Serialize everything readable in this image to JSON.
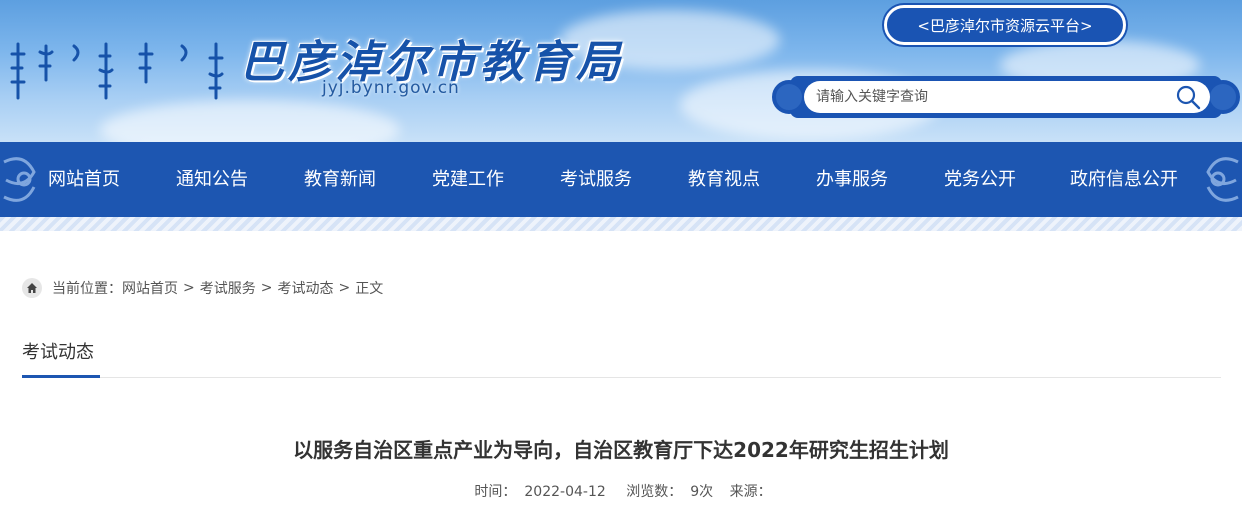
{
  "header": {
    "site_title": "巴彦淖尔市教育局",
    "site_domain": "jyj.bynr.gov.cn",
    "platform_link": "<巴彦淖尔市资源云平台>",
    "search_placeholder": "请输入关键字查询"
  },
  "nav": {
    "items": [
      "网站首页",
      "通知公告",
      "教育新闻",
      "党建工作",
      "考试服务",
      "教育视点",
      "办事服务",
      "党务公开",
      "政府信息公开"
    ]
  },
  "breadcrumb": {
    "label": "当前位置：",
    "items": [
      "网站首页",
      "考试服务",
      "考试动态",
      "正文"
    ],
    "separator": ">"
  },
  "section": {
    "title": "考试动态"
  },
  "article": {
    "title": "以服务自治区重点产业为导向，自治区教育厅下达2022年研究生招生计划",
    "time_label": "时间：",
    "time": "2022-04-12",
    "views_label": "浏览数：",
    "views": "9次",
    "source_label": "来源："
  },
  "colors": {
    "primary": "#1d56b1",
    "sky": "#7cb5ec"
  }
}
